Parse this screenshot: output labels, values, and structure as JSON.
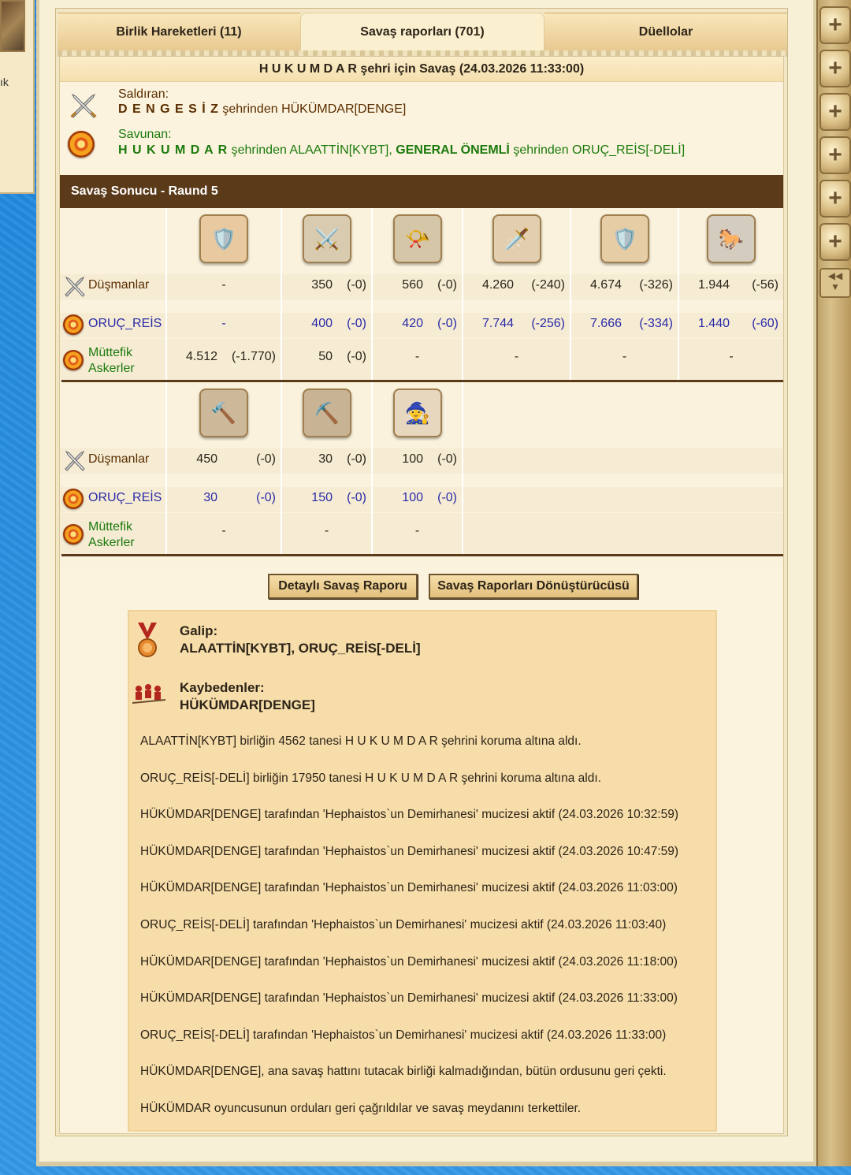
{
  "left_panel": {
    "cut_text": "ık"
  },
  "tabs": [
    {
      "label": "Birlik Hareketleri (11)"
    },
    {
      "label": "Savaş raporları (701)"
    },
    {
      "label": "Düellolar"
    }
  ],
  "report": {
    "title_city": "H U K U M D A R",
    "title_rest": " şehri için Savaş (24.03.2026 11:33:00)",
    "attacker": {
      "heading": "Saldıran:",
      "city": "D E N G E S İ Z",
      "text": " şehrinden HÜKÜMDAR[DENGE]"
    },
    "defender": {
      "heading": "Savunan:",
      "city": "H U K U M D A R",
      "text1": " şehrinden ALAATTİN[KYBT], ",
      "city2": "GENERAL ÖNEMLİ",
      "text2": " şehrinden ORUÇ_REİS[-DELİ]"
    },
    "result_title": "Savaş Sonucu - Raund 5",
    "rows": {
      "enemies": "Düşmanlar",
      "player": "ORUÇ_REİS",
      "allies_l1": "Müttefik",
      "allies_l2": "Askerler"
    },
    "block1": {
      "enemies": [
        [
          "-",
          ""
        ],
        [
          "350",
          "(-0)"
        ],
        [
          "560",
          "(-0)"
        ],
        [
          "4.260",
          "(-240)"
        ],
        [
          "4.674",
          "(-326)"
        ],
        [
          "1.944",
          "(-56)"
        ]
      ],
      "player": [
        [
          "-",
          ""
        ],
        [
          "400",
          "(-0)"
        ],
        [
          "420",
          "(-0)"
        ],
        [
          "7.744",
          "(-256)"
        ],
        [
          "7.666",
          "(-334)"
        ],
        [
          "1.440",
          "(-60)"
        ]
      ],
      "allies": [
        [
          "4.512",
          "(-1.770)"
        ],
        [
          "50",
          "(-0)"
        ],
        [
          "-",
          ""
        ],
        [
          "-",
          ""
        ],
        [
          "-",
          ""
        ],
        [
          "-",
          ""
        ]
      ]
    },
    "block2": {
      "enemies": [
        [
          "450",
          "(-0)"
        ],
        [
          "30",
          "(-0)"
        ],
        [
          "100",
          "(-0)"
        ]
      ],
      "player": [
        [
          "30",
          "(-0)"
        ],
        [
          "150",
          "(-0)"
        ],
        [
          "100",
          "(-0)"
        ]
      ],
      "allies": [
        [
          "-",
          ""
        ],
        [
          "-",
          ""
        ],
        [
          "-",
          ""
        ]
      ]
    },
    "buttons": {
      "detail": "Detaylı Savaş Raporu",
      "converter": "Savaş Raporları Dönüştürücüsü"
    },
    "winner": {
      "heading": "Galip:",
      "names": "ALAATTİN[KYBT], ORUÇ_REİS[-DELİ]"
    },
    "loser": {
      "heading": "Kaybedenler:",
      "names": "HÜKÜMDAR[DENGE]"
    },
    "log": [
      "ALAATTİN[KYBT] birliğin 4562 tanesi H U K U M D A R şehrini koruma altına aldı.",
      "ORUÇ_REİS[-DELİ] birliğin 17950 tanesi H U K U M D A R şehrini koruma altına aldı.",
      "HÜKÜMDAR[DENGE] tarafından 'Hephaistos`un Demirhanesi' mucizesi aktif (24.03.2026 10:32:59)",
      "HÜKÜMDAR[DENGE] tarafından 'Hephaistos`un Demirhanesi' mucizesi aktif (24.03.2026 10:47:59)",
      "HÜKÜMDAR[DENGE] tarafından 'Hephaistos`un Demirhanesi' mucizesi aktif (24.03.2026 11:03:00)",
      "ORUÇ_REİS[-DELİ] tarafından 'Hephaistos`un Demirhanesi' mucizesi aktif (24.03.2026 11:03:40)",
      "HÜKÜMDAR[DENGE] tarafından 'Hephaistos`un Demirhanesi' mucizesi aktif (24.03.2026 11:18:00)",
      "HÜKÜMDAR[DENGE] tarafından 'Hephaistos`un Demirhanesi' mucizesi aktif (24.03.2026 11:33:00)",
      "ORUÇ_REİS[-DELİ] tarafından 'Hephaistos`un Demirhanesi' mucizesi aktif (24.03.2026 11:33:00)",
      "HÜKÜMDAR[DENGE], ana savaş hattını tutacak birliği kalmadığından, bütün ordusunu geri çekti.",
      "HÜKÜMDAR oyuncusunun orduları geri çağrıldılar ve savaş meydanını terkettiler."
    ]
  },
  "sidebar": {
    "buttons": [
      "plus-icon",
      "plus-icon",
      "plus-icon",
      "plus-icon",
      "plus-icon",
      "plus-icon"
    ],
    "collapse_icon": "double-chevron-left-icon"
  }
}
